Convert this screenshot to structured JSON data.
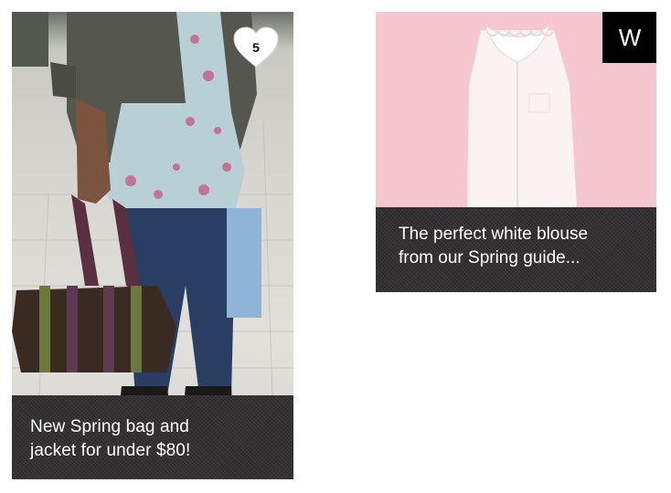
{
  "cards": [
    {
      "caption_line1": "New Spring bag and",
      "caption_line2": "jacket for under $80!",
      "likes": "5",
      "icon": "heart-icon"
    },
    {
      "caption_line1": "The perfect white blouse",
      "caption_line2": "from our Spring guide...",
      "brand_logo": "W"
    }
  ],
  "colors": {
    "caption_bg": "#333031",
    "blouse_bg": "#f6c7cf",
    "logo_bg": "#000000"
  }
}
